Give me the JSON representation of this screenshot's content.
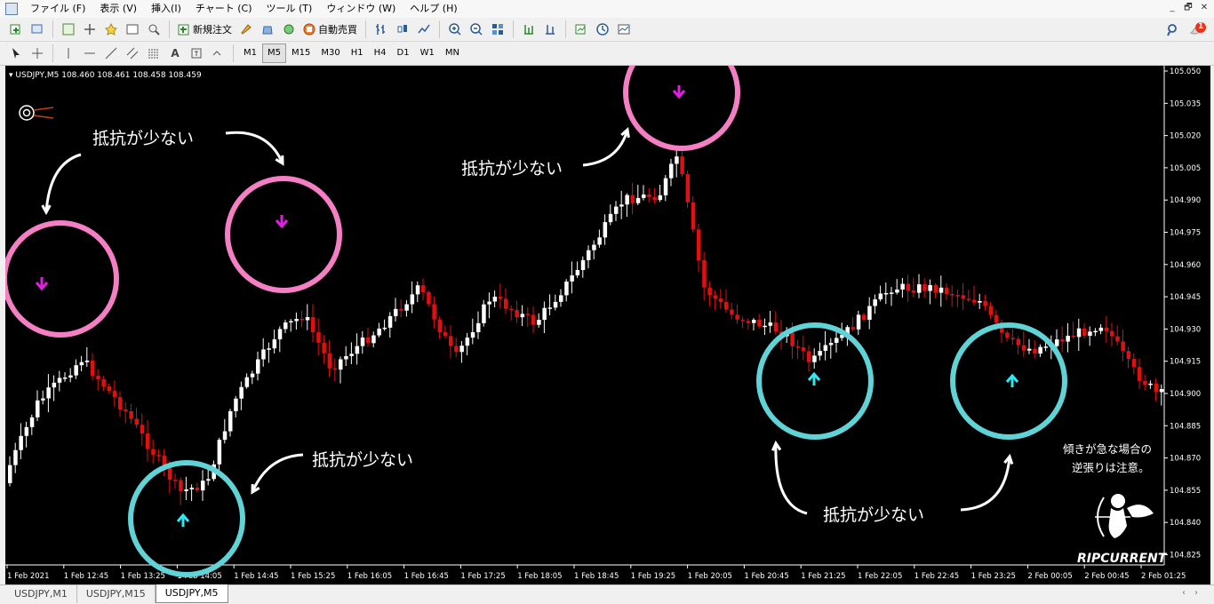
{
  "menu": [
    "ファイル (F)",
    "表示 (V)",
    "挿入(I)",
    "チャート (C)",
    "ツール (T)",
    "ウィンドウ (W)",
    "ヘルプ (H)"
  ],
  "window_buttons": [
    "_",
    "🗗",
    "✕"
  ],
  "toolbar": {
    "new_order_label": "新規注文",
    "auto_trade_label": "自動売買",
    "notification_count": "1"
  },
  "timeframes": [
    "M1",
    "M5",
    "M15",
    "M30",
    "H1",
    "H4",
    "D1",
    "W1",
    "MN"
  ],
  "active_timeframe": "M5",
  "chart": {
    "symbol_info": "USDJPY,M5  108.460 108.461 108.458 108.459",
    "bg_color": "#000000",
    "bull_color": "#ffffff",
    "bear_color": "#e01010",
    "price_ticks": [
      "105.050",
      "105.035",
      "105.020",
      "105.005",
      "104.990",
      "104.975",
      "104.960",
      "104.945",
      "104.930",
      "104.915",
      "104.900",
      "104.885",
      "104.870",
      "104.855",
      "104.840",
      "104.825"
    ],
    "time_ticks": [
      "1 Feb 2021",
      "1 Feb 12:45",
      "1 Feb 13:25",
      "1 Feb 14:05",
      "1 Feb 14:45",
      "1 Feb 15:25",
      "1 Feb 16:05",
      "1 Feb 16:45",
      "1 Feb 17:25",
      "1 Feb 18:05",
      "1 Feb 18:45",
      "1 Feb 19:25",
      "1 Feb 20:05",
      "1 Feb 20:45",
      "1 Feb 21:25",
      "1 Feb 22:05",
      "1 Feb 22:45",
      "1 Feb 23:25",
      "2 Feb 00:05",
      "2 Feb 00:45",
      "2 Feb 01:25"
    ],
    "annotation_text": "抵抗が少ない",
    "note_line1": "傾きが急な場合の",
    "note_line2": "逆張りは注意。",
    "brand": "RIPCURRENT",
    "pink_circle_color": "#f57fc4",
    "cyan_circle_color": "#5fd3d6",
    "down_arrow_color": "#e020e0",
    "up_arrow_color": "#30e8f0"
  },
  "tabs": [
    "USDJPY,M1",
    "USDJPY,M15",
    "USDJPY,M5"
  ],
  "active_tab": "USDJPY,M5"
}
